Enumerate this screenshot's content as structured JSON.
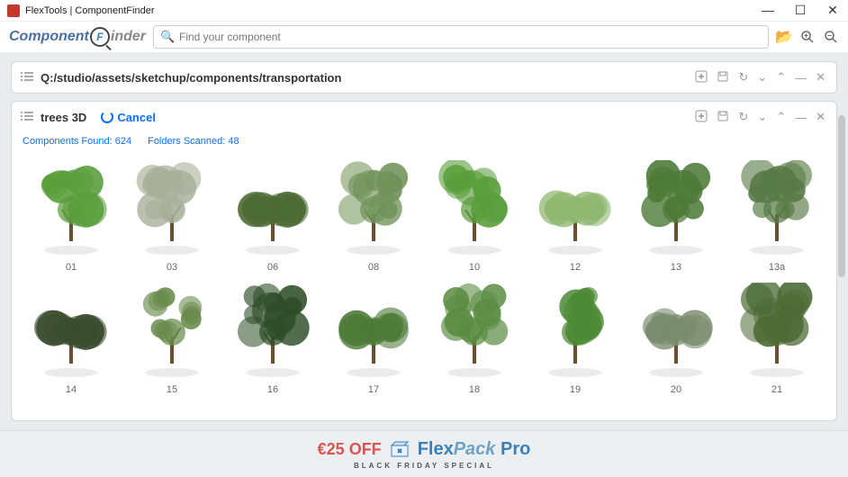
{
  "window": {
    "title": "FlexTools | ComponentFinder"
  },
  "logo": {
    "part1": "Component",
    "finder_letter": "F",
    "part2": "inder"
  },
  "search": {
    "placeholder": "Find your component"
  },
  "path_panel": {
    "path": "Q:/studio/assets/sketchup/components/transportation"
  },
  "results_panel": {
    "title": "trees 3D",
    "cancel_label": "Cancel"
  },
  "stats": {
    "components_label": "Components Found:",
    "components_count": "624",
    "folders_label": "Folders Scanned:",
    "folders_count": "48"
  },
  "items": [
    {
      "label": "01",
      "hue": "#5a9e3c"
    },
    {
      "label": "03",
      "hue": "#a8b09a"
    },
    {
      "label": "06",
      "hue": "#4d6b36"
    },
    {
      "label": "08",
      "hue": "#71935a"
    },
    {
      "label": "10",
      "hue": "#5a9e3c"
    },
    {
      "label": "12",
      "hue": "#8fb770"
    },
    {
      "label": "13",
      "hue": "#4d7a38"
    },
    {
      "label": "13a",
      "hue": "#587a46"
    },
    {
      "label": "14",
      "hue": "#3a4d2e"
    },
    {
      "label": "15",
      "hue": "#6a8c4e"
    },
    {
      "label": "16",
      "hue": "#2e4d28"
    },
    {
      "label": "17",
      "hue": "#4d7a38"
    },
    {
      "label": "18",
      "hue": "#5a8c42"
    },
    {
      "label": "19",
      "hue": "#4d8a36"
    },
    {
      "label": "20",
      "hue": "#7a8c6e"
    },
    {
      "label": "21",
      "hue": "#4d6b36"
    }
  ],
  "banner": {
    "price": "€25 OFF",
    "brand_flex": "Flex",
    "brand_pack": "Pack",
    "brand_pro": " Pro",
    "sub": "BLACK FRIDAY SPECIAL"
  }
}
